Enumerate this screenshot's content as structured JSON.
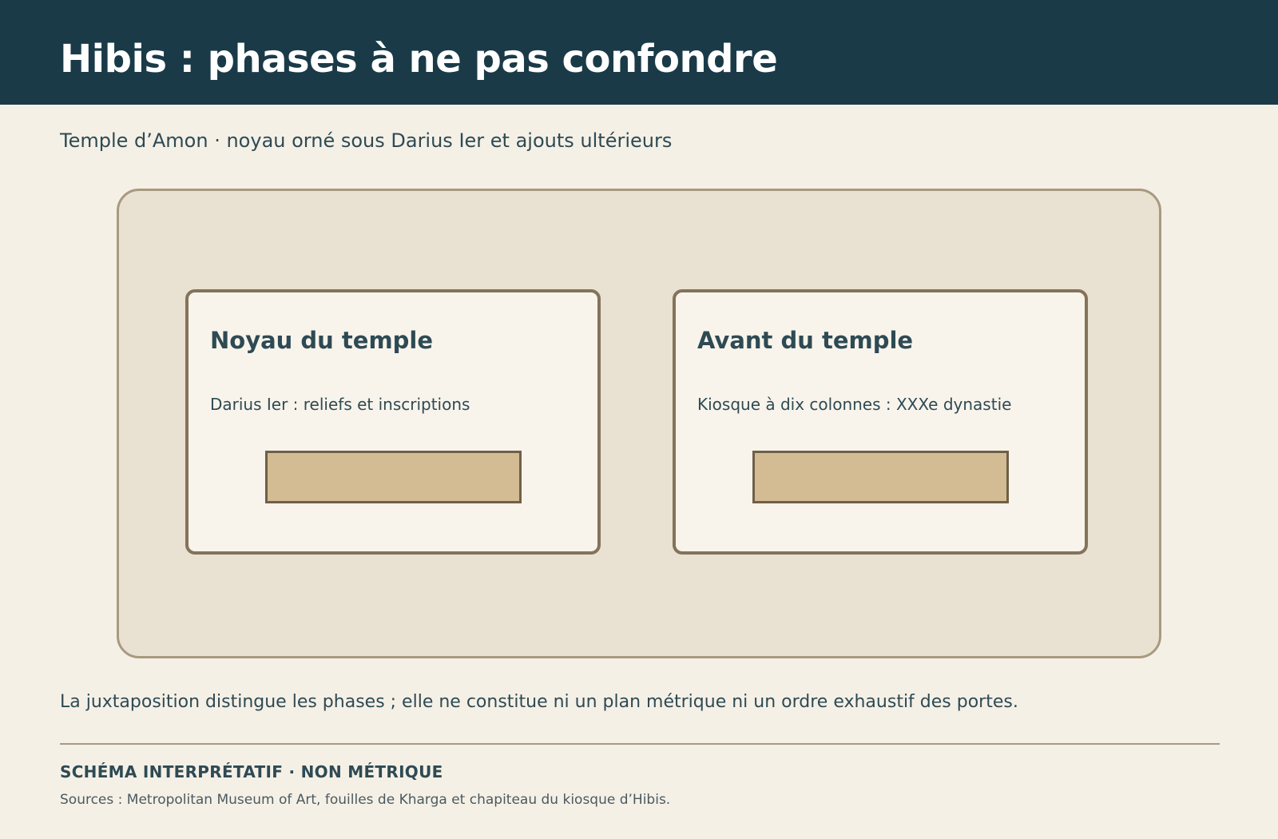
{
  "header": {
    "title": "Hibis : phases à ne pas confondre"
  },
  "subtitle": "Temple d’Amon · noyau orné sous Darius Ier et ajouts ultérieurs",
  "diagram": {
    "cards": [
      {
        "title": "Noyau du temple",
        "text": "Darius Ier : reliefs et inscriptions"
      },
      {
        "title": "Avant du temple",
        "text": "Kiosque à dix colonnes : XXXe dynastie"
      }
    ]
  },
  "note": "La juxtaposition distingue les phases ; elle ne constitue ni un plan métrique ni un ordre exhaustif des portes.",
  "footer": {
    "label": "SCHÉMA INTERPRÉTATIF · NON MÉTRIQUE",
    "sources": "Sources : Metropolitan Museum of Art, fouilles de Kharga et chapiteau du kiosque d’Hibis."
  },
  "colors": {
    "header_bg": "#1a3a48",
    "page_bg": "#f5f0e6",
    "stage_bg": "#e9e1d2",
    "card_bg": "#f8f4eb",
    "card_border": "#84735a",
    "block_fill": "#d3bc94",
    "text": "#2e4a54"
  }
}
